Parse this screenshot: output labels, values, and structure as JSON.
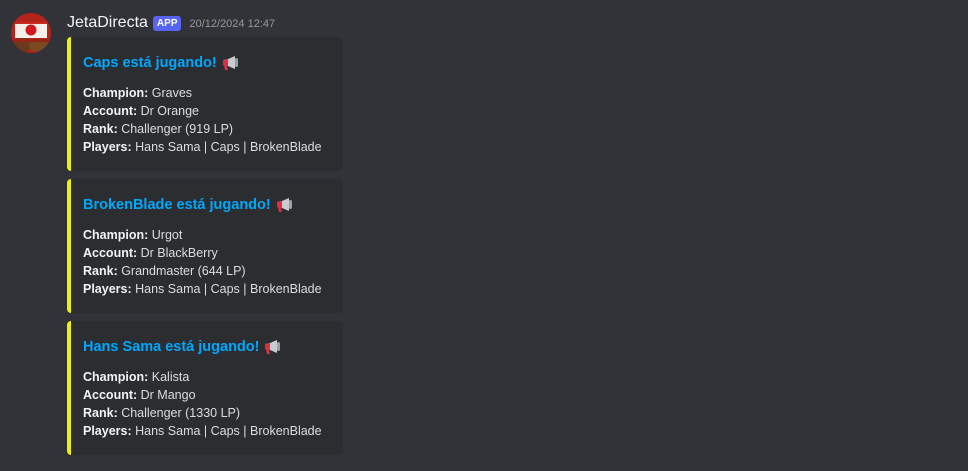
{
  "message": {
    "username": "JetaDirecta",
    "badge": "APP",
    "timestamp": "20/12/2024 12:47",
    "avatar_icon": "red-sun-flag-avatar"
  },
  "colors": {
    "background": "#313338",
    "embed_background": "#2b2d31",
    "embed_accent": "#ecf012",
    "link": "#00a8fc",
    "badge": "#5865f2"
  },
  "embeds": [
    {
      "title": "Caps está jugando!",
      "icon": "megaphone-icon",
      "fields": [
        {
          "label": "Champion:",
          "value": " Graves"
        },
        {
          "label": "Account:",
          "value": " Dr Orange"
        },
        {
          "label": "Rank:",
          "value": " Challenger (919 LP)"
        },
        {
          "label": "Players:",
          "value": " Hans Sama | Caps | BrokenBlade"
        }
      ]
    },
    {
      "title": "BrokenBlade está jugando!",
      "icon": "megaphone-icon",
      "fields": [
        {
          "label": "Champion:",
          "value": " Urgot"
        },
        {
          "label": "Account:",
          "value": " Dr BlackBerry"
        },
        {
          "label": "Rank:",
          "value": " Grandmaster (644 LP)"
        },
        {
          "label": "Players:",
          "value": " Hans Sama | Caps | BrokenBlade"
        }
      ]
    },
    {
      "title": "Hans Sama está jugando!",
      "icon": "megaphone-icon",
      "fields": [
        {
          "label": "Champion:",
          "value": " Kalista"
        },
        {
          "label": "Account:",
          "value": " Dr Mango"
        },
        {
          "label": "Rank:",
          "value": " Challenger (1330 LP)"
        },
        {
          "label": "Players:",
          "value": " Hans Sama | Caps | BrokenBlade"
        }
      ]
    }
  ]
}
